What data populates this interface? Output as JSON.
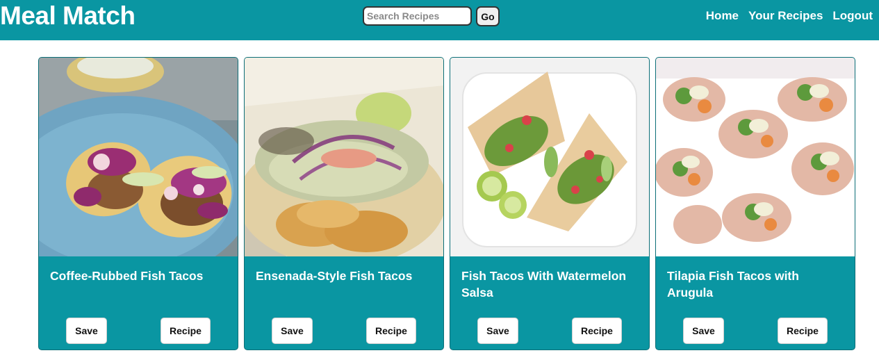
{
  "header": {
    "brand": "Meal Match",
    "search": {
      "placeholder": "Search Recipes",
      "value": "",
      "button_label": "Go"
    },
    "nav": [
      "Home",
      "Your Recipes",
      "Logout"
    ]
  },
  "recipes": [
    {
      "title": "Coffee-Rubbed Fish Tacos",
      "save_label": "Save",
      "recipe_label": "Recipe"
    },
    {
      "title": "Ensenada-Style Fish Tacos",
      "save_label": "Save",
      "recipe_label": "Recipe"
    },
    {
      "title": "Fish Tacos With Watermelon Salsa",
      "save_label": "Save",
      "recipe_label": "Recipe"
    },
    {
      "title": "Tilapia Fish Tacos with Arugula",
      "save_label": "Save",
      "recipe_label": "Recipe"
    }
  ],
  "colors": {
    "brand": "#0a96a2",
    "card_border": "#0b6e77"
  }
}
